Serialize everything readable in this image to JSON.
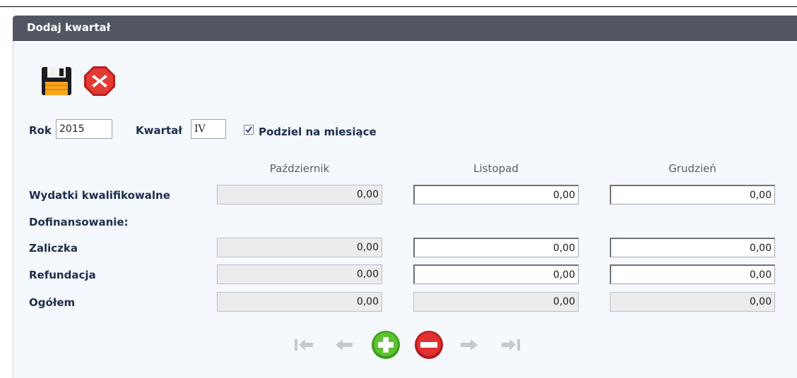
{
  "panel": {
    "title": "Dodaj kwartał"
  },
  "toolbar": {
    "save_icon": "floppy-disk-icon",
    "cancel_icon": "close-icon"
  },
  "form": {
    "rok_label": "Rok",
    "rok_value": "2015",
    "kwartal_label": "Kwartał",
    "kwartal_value": "IV",
    "podziel_label": "Podziel na miesiące",
    "podziel_checked": true
  },
  "table": {
    "columns": [
      "Październik",
      "Listopad",
      "Grudzień"
    ],
    "rows": [
      {
        "label": "Wydatki kwalifikowalne",
        "values": [
          "0,00",
          "0,00",
          "0,00"
        ]
      },
      {
        "label": "Dofinansowanie:",
        "values": []
      },
      {
        "label": "Zaliczka",
        "values": [
          "0,00",
          "0,00",
          "0,00"
        ]
      },
      {
        "label": "Refundacja",
        "values": [
          "0,00",
          "0,00",
          "0,00"
        ]
      },
      {
        "label": "Ogółem",
        "values": [
          "0,00",
          "0,00",
          "0,00"
        ]
      }
    ]
  },
  "navigation": {
    "icons": [
      "first-icon",
      "previous-icon",
      "add-icon",
      "remove-icon",
      "next-icon",
      "last-icon"
    ],
    "colors": {
      "disabled": "#c4c8cc",
      "add": "#4caf2a",
      "remove": "#d8262a"
    }
  }
}
